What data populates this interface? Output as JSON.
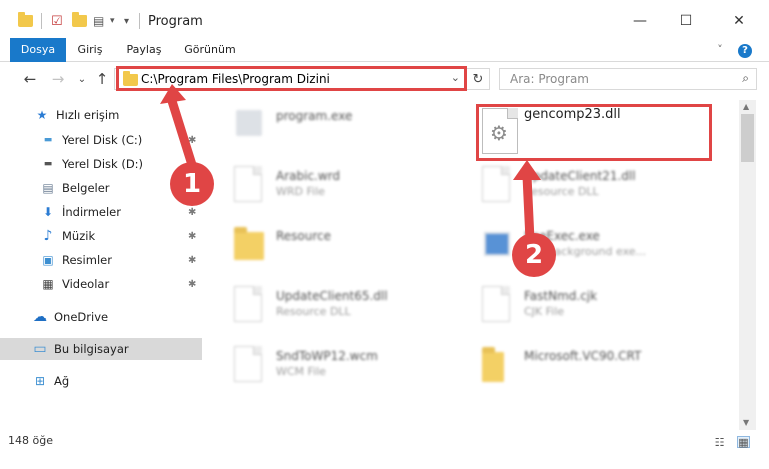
{
  "window": {
    "title": "Program",
    "min_glyph": "—",
    "max_glyph": "☐",
    "close_glyph": "✕"
  },
  "ribbon": {
    "tabs": [
      "Dosya",
      "Giriş",
      "Paylaş",
      "Görünüm"
    ],
    "expand_glyph": "˅",
    "help_glyph": "?"
  },
  "address": {
    "path": "C:\\Program Files\\Program Dizini",
    "caret": "⌄",
    "refresh_glyph": "↻"
  },
  "search": {
    "placeholder": "Ara: Program",
    "icon_glyph": "⌕"
  },
  "nav": {
    "back": "←",
    "forward": "→",
    "recent": "⌄",
    "up": "↑"
  },
  "sidebar": {
    "items": [
      {
        "label": "Hızlı erişim",
        "icon": "star-icon",
        "glyph": "★"
      },
      {
        "label": "Yerel Disk (C:)",
        "icon": "drive-icon",
        "glyph": "▬"
      },
      {
        "label": "Yerel Disk (D:)",
        "icon": "drive-icon",
        "glyph": "▬"
      },
      {
        "label": "Belgeler",
        "icon": "documents-icon",
        "glyph": "▤"
      },
      {
        "label": "İndirmeler",
        "icon": "download-icon",
        "glyph": "⬇"
      },
      {
        "label": "Müzik",
        "icon": "music-icon",
        "glyph": "♪"
      },
      {
        "label": "Resimler",
        "icon": "pictures-icon",
        "glyph": "▣"
      },
      {
        "label": "Videolar",
        "icon": "videos-icon",
        "glyph": "▦"
      },
      {
        "label": "OneDrive",
        "icon": "cloud-icon",
        "glyph": "☁"
      },
      {
        "label": "Bu bilgisayar",
        "icon": "computer-icon",
        "glyph": "▭"
      },
      {
        "label": "Ağ",
        "icon": "network-icon",
        "glyph": "⊞"
      }
    ],
    "pin_glyph": "✱"
  },
  "files": {
    "left": [
      {
        "name": "program.exe",
        "type": ""
      },
      {
        "name": "Arabic.wrd",
        "type": "WRD File"
      },
      {
        "name": "Resource",
        "type": ""
      },
      {
        "name": "UpdateClient65.dll",
        "type": "Resource DLL"
      },
      {
        "name": "SndToWP12.wcm",
        "type": "WCM File"
      }
    ],
    "right": [
      {
        "name": "gencomp23.dll",
        "type": ""
      },
      {
        "name": "UpdateClient21.dll",
        "type": "Resource DLL"
      },
      {
        "name": "UseExec.exe",
        "type": "SPF background exe..."
      },
      {
        "name": "FastNmd.cjk",
        "type": "CJK File"
      },
      {
        "name": "Microsoft.VC90.CRT",
        "type": ""
      }
    ],
    "gear_glyph": "⚙"
  },
  "callouts": [
    "1",
    "2"
  ],
  "status": {
    "count": "148 öğe"
  },
  "scroll": {
    "up": "▲",
    "down": "▼"
  },
  "colors": {
    "accent": "#1979ca",
    "annotation": "#e04545"
  }
}
